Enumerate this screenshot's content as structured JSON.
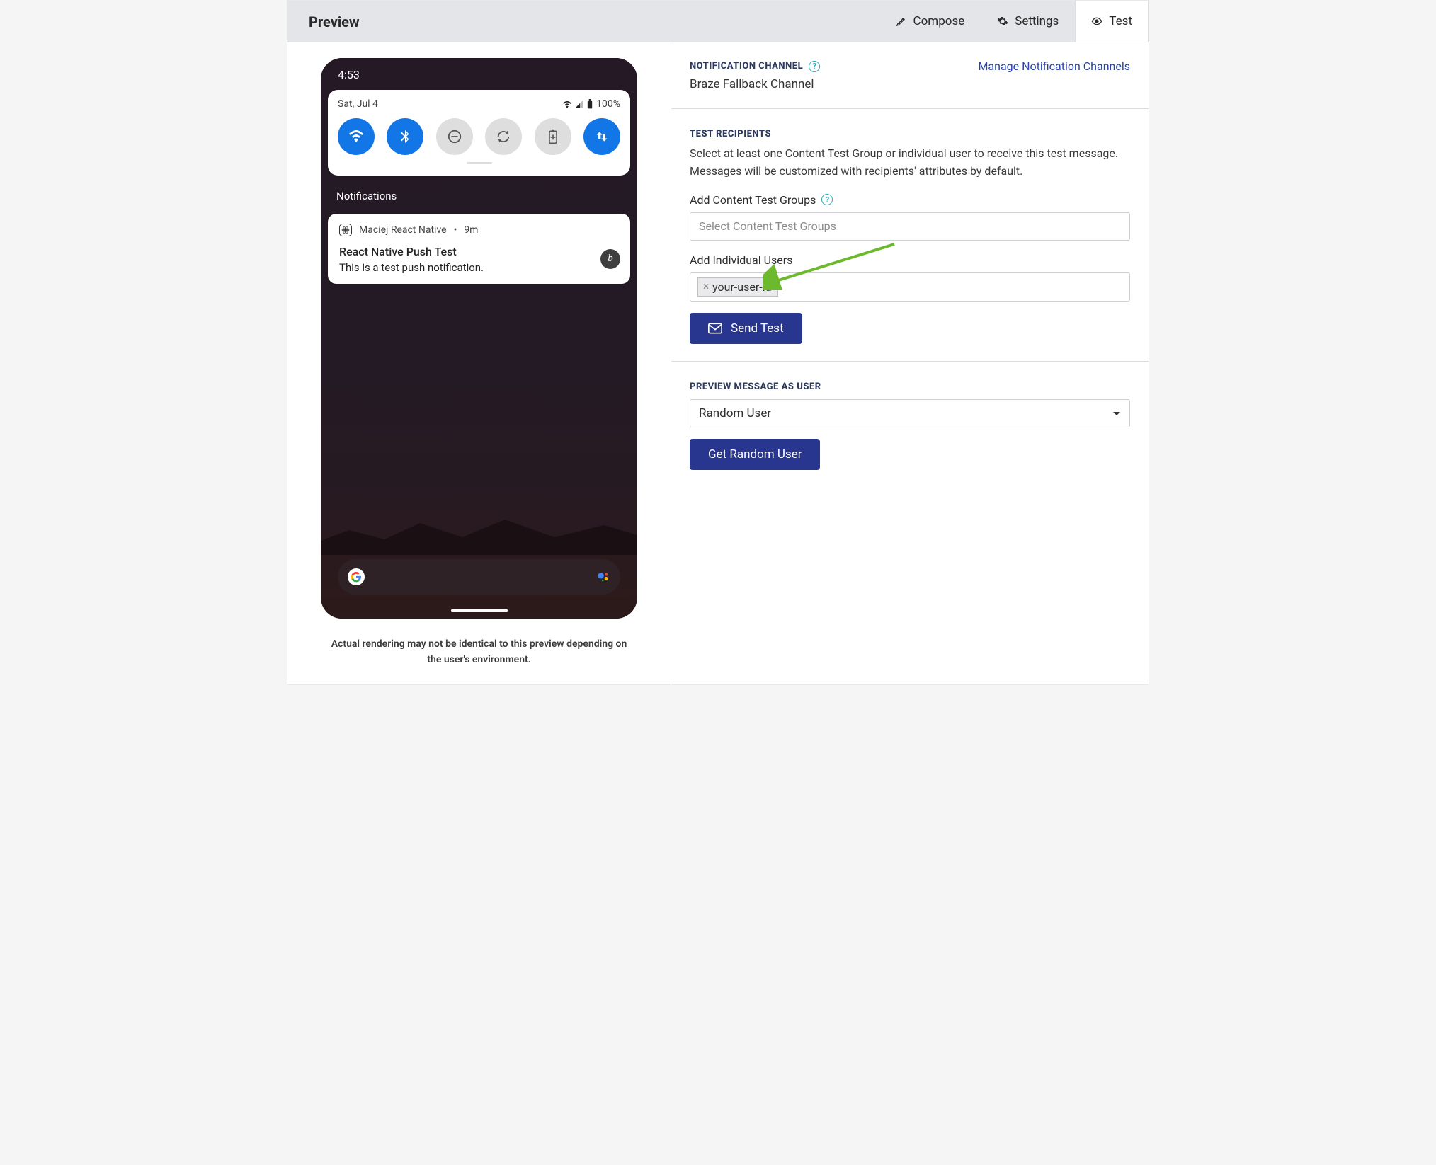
{
  "header": {
    "title": "Preview",
    "tabs": [
      {
        "label": "Compose"
      },
      {
        "label": "Settings"
      },
      {
        "label": "Test"
      }
    ]
  },
  "phone": {
    "time": "4:53",
    "date": "Sat, Jul 4",
    "battery": "100%",
    "notifications_label": "Notifications",
    "notif": {
      "app_name": "Maciej React Native",
      "age": "9m",
      "title": "React Native Push Test",
      "body": "This is a test push notification.",
      "app_badge": "b"
    },
    "google_g": "G"
  },
  "disclaimer": "Actual rendering may not be identical to this preview depending on the user's environment.",
  "notification_channel": {
    "heading": "NOTIFICATION CHANNEL",
    "value": "Braze Fallback Channel",
    "manage_link": "Manage Notification Channels"
  },
  "test_recipients": {
    "heading": "TEST RECIPIENTS",
    "desc": "Select at least one Content Test Group or individual user to receive this test message. Messages will be customized with recipients' attributes by default.",
    "groups_label": "Add Content Test Groups",
    "groups_placeholder": "Select Content Test Groups",
    "users_label": "Add Individual Users",
    "user_chip": "your-user-id",
    "send_button": "Send Test"
  },
  "preview_as_user": {
    "heading": "PREVIEW MESSAGE AS USER",
    "select_value": "Random User",
    "button": "Get Random User"
  }
}
